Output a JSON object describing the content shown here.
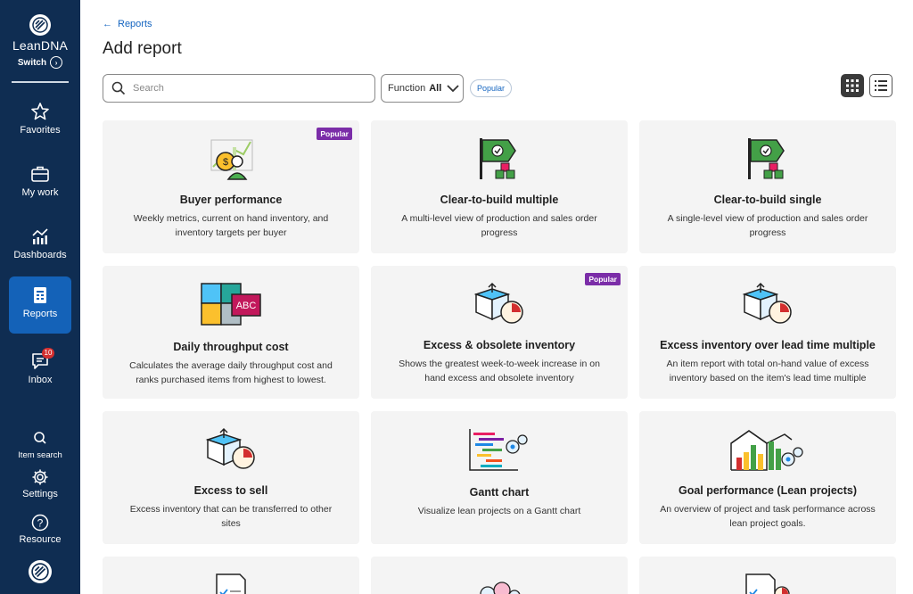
{
  "sidebar": {
    "brand_name": "LeanDNA",
    "switch_label": "Switch",
    "items": [
      {
        "label": "Favorites",
        "icon": "star-icon"
      },
      {
        "label": "My work",
        "icon": "briefcase-icon"
      },
      {
        "label": "Dashboards",
        "icon": "chart-icon"
      },
      {
        "label": "Reports",
        "icon": "report-icon",
        "active": true
      },
      {
        "label": "Inbox",
        "icon": "inbox-icon",
        "badge": "10"
      }
    ],
    "bottom": [
      {
        "label": "Item search",
        "icon": "search-icon"
      },
      {
        "label": "Settings",
        "icon": "gear-icon"
      },
      {
        "label": "Resource",
        "icon": "help-icon"
      }
    ]
  },
  "header": {
    "back_label": "Reports",
    "title": "Add report"
  },
  "filters": {
    "search_placeholder": "Search",
    "function_label": "Function",
    "function_value": "All",
    "popular_chip": "Popular"
  },
  "colors": {
    "sidebar": "#0f2d52",
    "active": "#1462b8",
    "popular": "#7b2da8",
    "link": "#1565c0"
  },
  "cards": [
    {
      "title": "Buyer performance",
      "description": "Weekly metrics, current on hand inventory, and inventory targets per buyer",
      "badge": "Popular",
      "illustration": "buyer-illustration"
    },
    {
      "title": "Clear-to-build multiple",
      "description": "A multi-level view of production and sales order progress",
      "badge": "",
      "illustration": "flag-boxes-illustration"
    },
    {
      "title": "Clear-to-build single",
      "description": "A single-level view of production and sales order progress",
      "badge": "",
      "illustration": "flag-boxes-illustration"
    },
    {
      "title": "Daily throughput cost",
      "description": "Calculates the average daily throughput cost and ranks purchased items from highest to lowest.",
      "badge": "",
      "illustration": "puzzle-illustration",
      "abc": "ABC"
    },
    {
      "title": "Excess & obsolete inventory",
      "description": "Shows the greatest week-to-week increase in on hand excess and obsolete inventory",
      "badge": "Popular",
      "illustration": "box-clock-illustration"
    },
    {
      "title": "Excess inventory over lead time multiple",
      "description": "An item report with total on-hand value of excess inventory based on the item's lead time multiple",
      "badge": "",
      "illustration": "box-clock-illustration"
    },
    {
      "title": "Excess to sell",
      "description": "Excess inventory that can be transferred to other sites",
      "badge": "",
      "illustration": "box-clock-illustration"
    },
    {
      "title": "Gantt chart",
      "description": "Visualize lean projects on a Gantt chart",
      "badge": "",
      "illustration": "gantt-illustration"
    },
    {
      "title": "Goal performance (Lean projects)",
      "description": "An overview of project and task performance across lean project goals.",
      "badge": "",
      "illustration": "goal-chart-illustration"
    }
  ]
}
